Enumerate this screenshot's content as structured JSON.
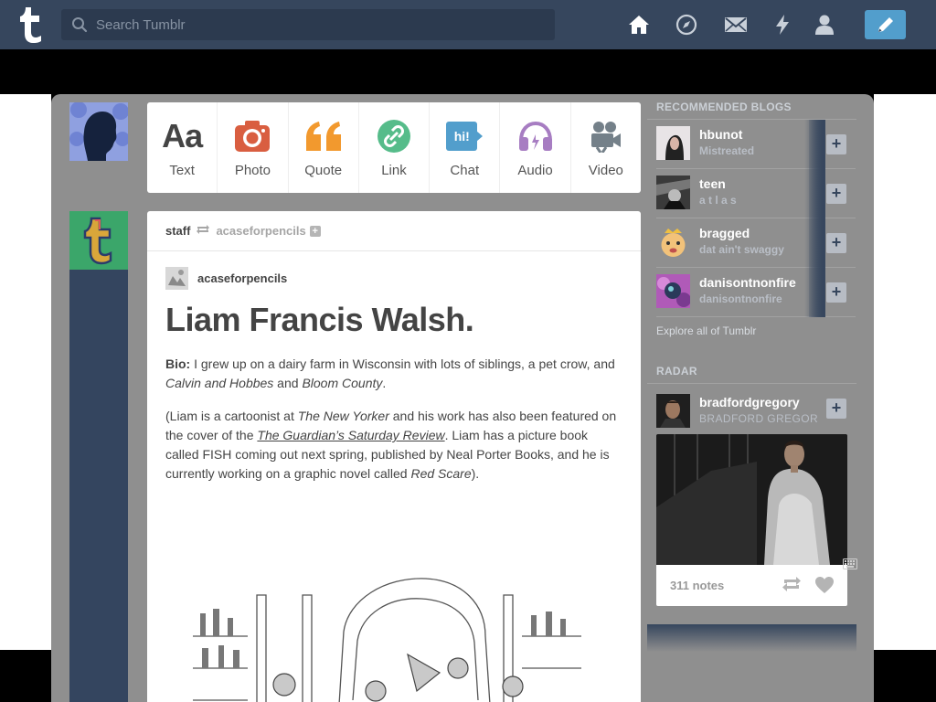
{
  "header": {
    "search_placeholder": "Search Tumblr",
    "nav": [
      "home-icon",
      "explore-icon",
      "inbox-icon",
      "activity-icon",
      "account-icon"
    ],
    "compose_icon": "pencil-icon",
    "colors": {
      "bar": "#36465d",
      "compose": "#529ecc"
    }
  },
  "composer": {
    "types": [
      {
        "label": "Text",
        "icon": "text-icon",
        "glyph": "Aa"
      },
      {
        "label": "Photo",
        "icon": "camera-icon"
      },
      {
        "label": "Quote",
        "icon": "quote-icon",
        "glyph": "66"
      },
      {
        "label": "Link",
        "icon": "link-icon"
      },
      {
        "label": "Chat",
        "icon": "chat-icon",
        "glyph": "hi!"
      },
      {
        "label": "Audio",
        "icon": "headphones-icon"
      },
      {
        "label": "Video",
        "icon": "video-camera-icon"
      }
    ],
    "colors": {
      "Text": "#444444",
      "Photo": "#d95e40",
      "Quote": "#f2992e",
      "Link": "#56bc8a",
      "Chat": "#529ecc",
      "Audio": "#a77dc2",
      "Video": "#748089"
    }
  },
  "post": {
    "author": "staff",
    "reblogged_from": "acaseforpencils",
    "content_author": "acaseforpencils",
    "title": "Liam Francis Walsh.",
    "bio_label": "Bio:",
    "bio_text_1": " I grew up on a dairy farm in Wisconsin with lots of siblings, a pet crow, and ",
    "bio_em_1": "Calvin and Hobbes",
    "bio_text_2": " and ",
    "bio_em_2": "Bloom County",
    "bio_text_3": ".",
    "p2_text_1": "(Liam is a cartoonist at ",
    "p2_em_1": "The New Yorker",
    "p2_text_2": " and his work has also been featured on the cover of the ",
    "p2_link": "The Guardian’s Saturday Review",
    "p2_text_3": ". Liam has a picture book called FISH coming out next spring, published by Neal Porter Books, and he is currently working on a graphic novel called ",
    "p2_em_2": "Red Scare",
    "p2_text_4": ")."
  },
  "sidebar": {
    "recommended_title": "RECOMMENDED BLOGS",
    "blogs": [
      {
        "name": "hbunot",
        "desc": "Mistreated"
      },
      {
        "name": "teen",
        "desc": "a t l a s"
      },
      {
        "name": "bragged",
        "desc": "dat ain't swaggy"
      },
      {
        "name": "danisontnonfire",
        "desc": "danisontnonfire"
      }
    ],
    "explore": "Explore all of Tumblr",
    "radar_title": "RADAR",
    "radar": {
      "name": "bradfordgregory",
      "desc": "BRADFORD GREGOR",
      "notes": "311 notes"
    }
  }
}
